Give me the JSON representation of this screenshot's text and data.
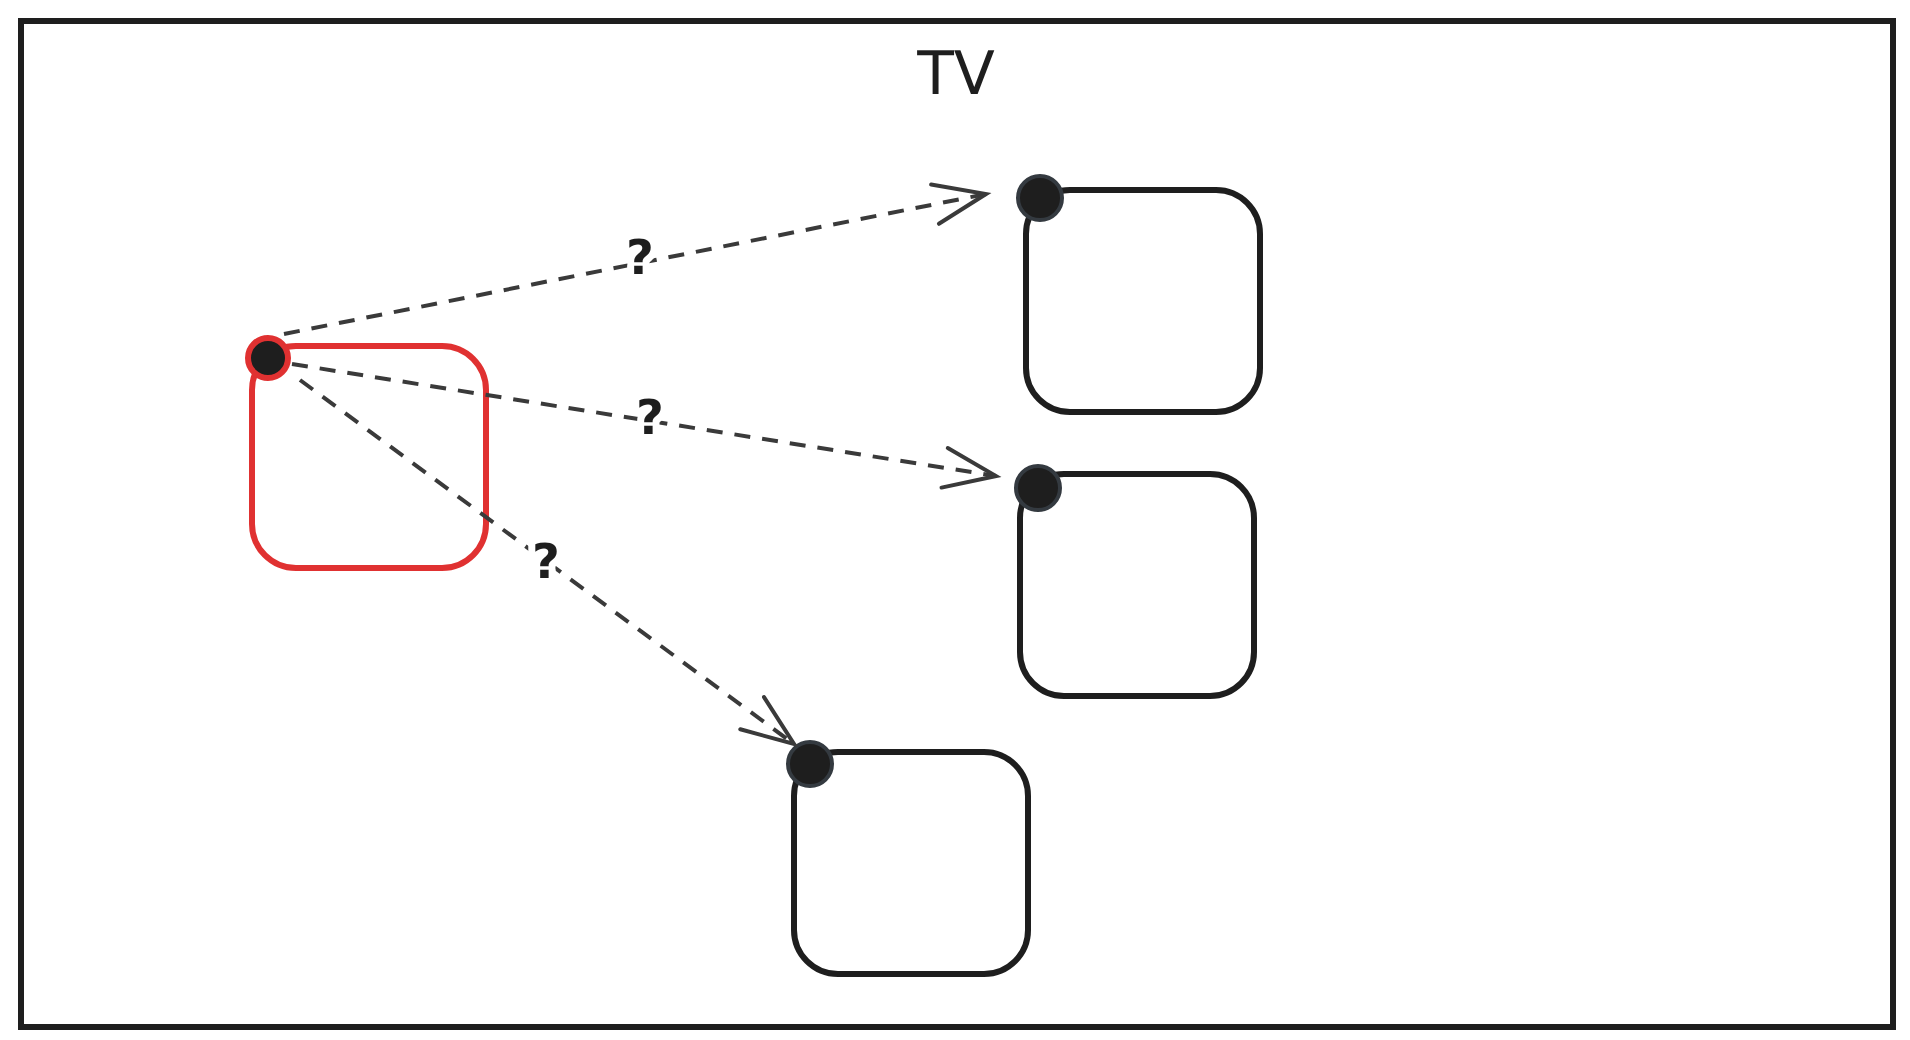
{
  "diagram": {
    "title": "TV",
    "nodes": [
      {
        "selected": true
      },
      {
        "selected": false
      },
      {
        "selected": false
      },
      {
        "selected": false
      }
    ],
    "edges": [
      {
        "label": "?"
      },
      {
        "label": "?"
      },
      {
        "label": "?"
      }
    ]
  }
}
